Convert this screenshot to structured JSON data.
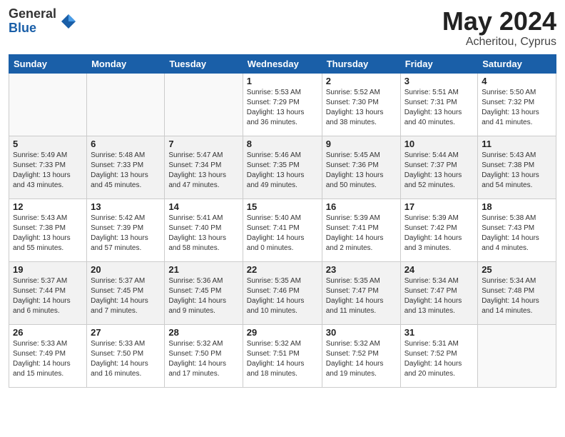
{
  "logo": {
    "general": "General",
    "blue": "Blue"
  },
  "title": {
    "month_year": "May 2024",
    "location": "Acheritou, Cyprus"
  },
  "calendar": {
    "headers": [
      "Sunday",
      "Monday",
      "Tuesday",
      "Wednesday",
      "Thursday",
      "Friday",
      "Saturday"
    ],
    "weeks": [
      [
        {
          "day": "",
          "info": ""
        },
        {
          "day": "",
          "info": ""
        },
        {
          "day": "",
          "info": ""
        },
        {
          "day": "1",
          "info": "Sunrise: 5:53 AM\nSunset: 7:29 PM\nDaylight: 13 hours\nand 36 minutes."
        },
        {
          "day": "2",
          "info": "Sunrise: 5:52 AM\nSunset: 7:30 PM\nDaylight: 13 hours\nand 38 minutes."
        },
        {
          "day": "3",
          "info": "Sunrise: 5:51 AM\nSunset: 7:31 PM\nDaylight: 13 hours\nand 40 minutes."
        },
        {
          "day": "4",
          "info": "Sunrise: 5:50 AM\nSunset: 7:32 PM\nDaylight: 13 hours\nand 41 minutes."
        }
      ],
      [
        {
          "day": "5",
          "info": "Sunrise: 5:49 AM\nSunset: 7:33 PM\nDaylight: 13 hours\nand 43 minutes."
        },
        {
          "day": "6",
          "info": "Sunrise: 5:48 AM\nSunset: 7:33 PM\nDaylight: 13 hours\nand 45 minutes."
        },
        {
          "day": "7",
          "info": "Sunrise: 5:47 AM\nSunset: 7:34 PM\nDaylight: 13 hours\nand 47 minutes."
        },
        {
          "day": "8",
          "info": "Sunrise: 5:46 AM\nSunset: 7:35 PM\nDaylight: 13 hours\nand 49 minutes."
        },
        {
          "day": "9",
          "info": "Sunrise: 5:45 AM\nSunset: 7:36 PM\nDaylight: 13 hours\nand 50 minutes."
        },
        {
          "day": "10",
          "info": "Sunrise: 5:44 AM\nSunset: 7:37 PM\nDaylight: 13 hours\nand 52 minutes."
        },
        {
          "day": "11",
          "info": "Sunrise: 5:43 AM\nSunset: 7:38 PM\nDaylight: 13 hours\nand 54 minutes."
        }
      ],
      [
        {
          "day": "12",
          "info": "Sunrise: 5:43 AM\nSunset: 7:38 PM\nDaylight: 13 hours\nand 55 minutes."
        },
        {
          "day": "13",
          "info": "Sunrise: 5:42 AM\nSunset: 7:39 PM\nDaylight: 13 hours\nand 57 minutes."
        },
        {
          "day": "14",
          "info": "Sunrise: 5:41 AM\nSunset: 7:40 PM\nDaylight: 13 hours\nand 58 minutes."
        },
        {
          "day": "15",
          "info": "Sunrise: 5:40 AM\nSunset: 7:41 PM\nDaylight: 14 hours\nand 0 minutes."
        },
        {
          "day": "16",
          "info": "Sunrise: 5:39 AM\nSunset: 7:41 PM\nDaylight: 14 hours\nand 2 minutes."
        },
        {
          "day": "17",
          "info": "Sunrise: 5:39 AM\nSunset: 7:42 PM\nDaylight: 14 hours\nand 3 minutes."
        },
        {
          "day": "18",
          "info": "Sunrise: 5:38 AM\nSunset: 7:43 PM\nDaylight: 14 hours\nand 4 minutes."
        }
      ],
      [
        {
          "day": "19",
          "info": "Sunrise: 5:37 AM\nSunset: 7:44 PM\nDaylight: 14 hours\nand 6 minutes."
        },
        {
          "day": "20",
          "info": "Sunrise: 5:37 AM\nSunset: 7:45 PM\nDaylight: 14 hours\nand 7 minutes."
        },
        {
          "day": "21",
          "info": "Sunrise: 5:36 AM\nSunset: 7:45 PM\nDaylight: 14 hours\nand 9 minutes."
        },
        {
          "day": "22",
          "info": "Sunrise: 5:35 AM\nSunset: 7:46 PM\nDaylight: 14 hours\nand 10 minutes."
        },
        {
          "day": "23",
          "info": "Sunrise: 5:35 AM\nSunset: 7:47 PM\nDaylight: 14 hours\nand 11 minutes."
        },
        {
          "day": "24",
          "info": "Sunrise: 5:34 AM\nSunset: 7:47 PM\nDaylight: 14 hours\nand 13 minutes."
        },
        {
          "day": "25",
          "info": "Sunrise: 5:34 AM\nSunset: 7:48 PM\nDaylight: 14 hours\nand 14 minutes."
        }
      ],
      [
        {
          "day": "26",
          "info": "Sunrise: 5:33 AM\nSunset: 7:49 PM\nDaylight: 14 hours\nand 15 minutes."
        },
        {
          "day": "27",
          "info": "Sunrise: 5:33 AM\nSunset: 7:50 PM\nDaylight: 14 hours\nand 16 minutes."
        },
        {
          "day": "28",
          "info": "Sunrise: 5:32 AM\nSunset: 7:50 PM\nDaylight: 14 hours\nand 17 minutes."
        },
        {
          "day": "29",
          "info": "Sunrise: 5:32 AM\nSunset: 7:51 PM\nDaylight: 14 hours\nand 18 minutes."
        },
        {
          "day": "30",
          "info": "Sunrise: 5:32 AM\nSunset: 7:52 PM\nDaylight: 14 hours\nand 19 minutes."
        },
        {
          "day": "31",
          "info": "Sunrise: 5:31 AM\nSunset: 7:52 PM\nDaylight: 14 hours\nand 20 minutes."
        },
        {
          "day": "",
          "info": ""
        }
      ]
    ]
  }
}
